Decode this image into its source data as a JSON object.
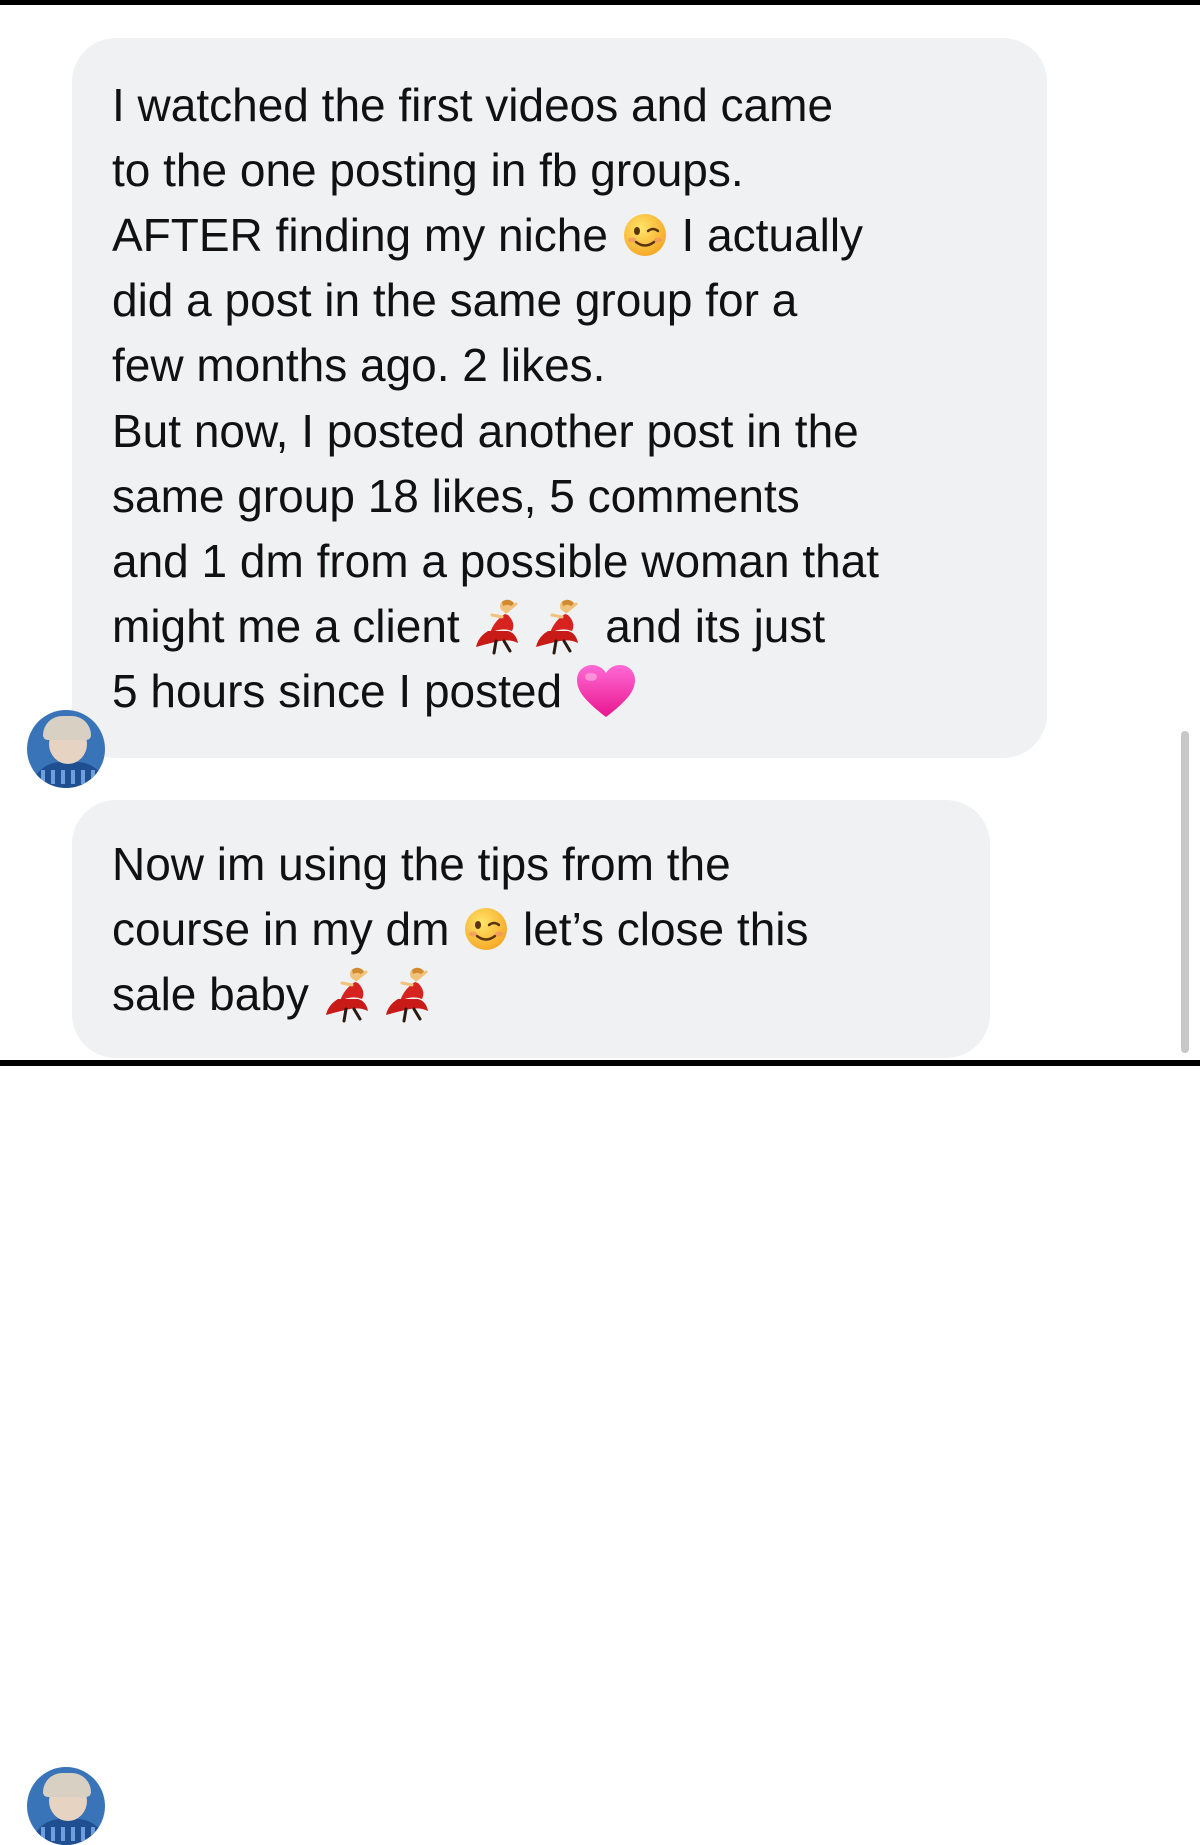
{
  "colors": {
    "bubble_background": "#f0f1f3",
    "text": "#111111",
    "scrollbar": "#c8c8c8",
    "rule": "#000000"
  },
  "icons": {
    "wink": "winking-face-emoji",
    "dancer": "woman-dancing-emoji",
    "heart": "pink-heart-emoji",
    "avatar": "sender-avatar"
  },
  "messages": [
    {
      "paragraphs": [
        {
          "before_wink": "I watched the first videos and came\nto the one posting in fb groups.\nAFTER finding my niche ",
          "after_wink": " I actually\ndid a post in the same group for a\nfew months ago. 2 likes."
        },
        {
          "before_dancers": "But now, I posted another post in the\nsame group 18 likes, 5 comments\nand 1 dm from a possible woman that\nmight me a client ",
          "after_dancers": " and its just\n5 hours since I posted "
        }
      ]
    },
    {
      "paragraphs": [
        {
          "before_wink": "Now im using the tips from the\ncourse in my dm ",
          "after_wink": " let’s close this\nsale baby "
        }
      ]
    }
  ]
}
